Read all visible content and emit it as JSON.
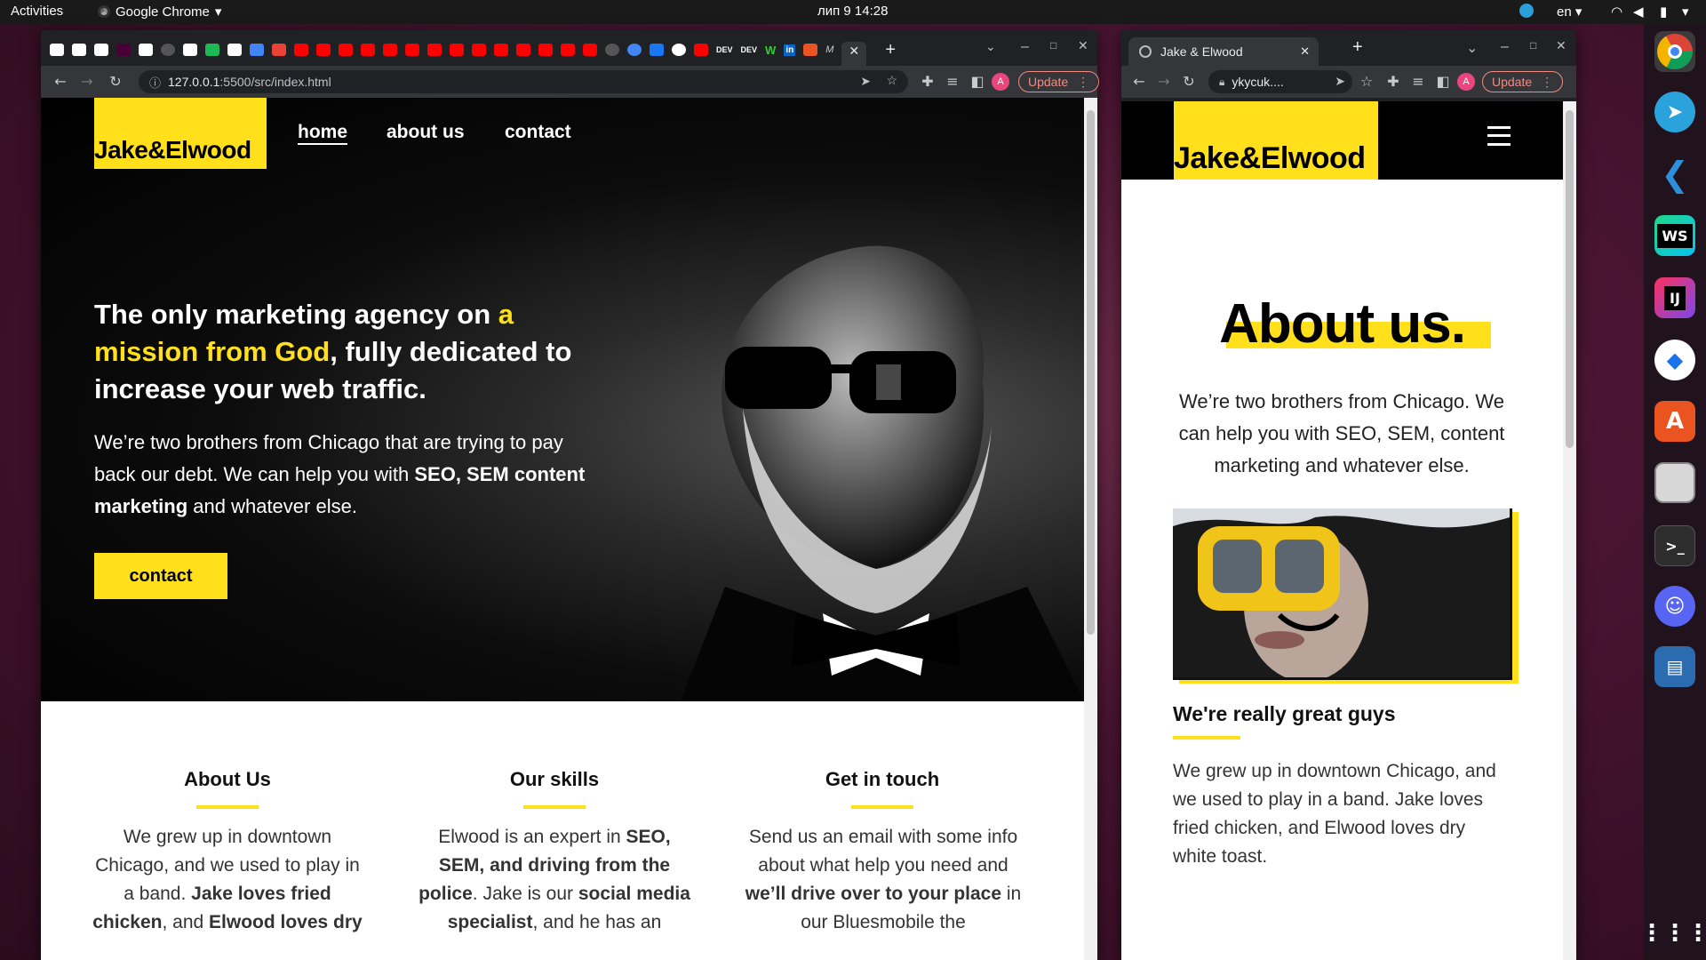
{
  "topbar": {
    "activities": "Activities",
    "app": "Google Chrome",
    "date_time": "лип 9  14:28",
    "lang": "en"
  },
  "win1": {
    "url_host": "127.0.0.1",
    "url_path": ":5500/src/index.html",
    "update": "Update",
    "avatar": "A",
    "tab_favicons": [
      "DEV",
      "DEV",
      "W",
      "in",
      "M"
    ]
  },
  "site": {
    "logo": "Jake&Elwood",
    "nav": [
      "home",
      "about us",
      "contact"
    ],
    "headline_1": "The only marketing agency on ",
    "headline_hl": "a mission from God",
    "headline_2": ", fully dedicated to increase your web traffic.",
    "lead_1": "We’re two brothers from Chicago that are trying to pay back our debt. We can help you with ",
    "lead_b1": "SEO, SEM content marketing",
    "lead_2": " and whatever else.",
    "cta": "contact",
    "cols": [
      {
        "title": "About Us",
        "t1": "We grew up in downtown Chicago, and we used to play in a band. ",
        "b1": "Jake loves fried chicken",
        "t2": ", and ",
        "b2": "Elwood loves dry"
      },
      {
        "title": "Our skills",
        "t1": "Elwood is an expert in ",
        "b1": "SEO, SEM, and driving from the police",
        "t2": ". Jake is our ",
        "b2": "social media specialist",
        "t3": ", and he has an"
      },
      {
        "title": "Get in touch",
        "t1": "Send us an email with some info about what help you need and ",
        "b1": "we’ll drive over to your place",
        "t2": " in our Bluesmobile the"
      }
    ]
  },
  "win2": {
    "tab_title": "Jake & Elwood",
    "url": "ykycuk....",
    "update": "Update",
    "avatar": "A",
    "about_title": "About us.",
    "about_text": "We’re two brothers from Chicago. We can help you with SEO, SEM, content marketing and whatever else.",
    "subhead": "We're really great guys",
    "body": "We grew up in downtown Chicago, and we used to play in a band. Jake loves fried chicken, and Elwood loves dry white toast."
  },
  "dock": [
    "chrome-icon",
    "telegram-icon",
    "vscode-icon",
    "webstorm-icon",
    "intellij-icon",
    "maps-icon",
    "software-center-icon",
    "files-icon",
    "terminal-icon",
    "discord-icon",
    "document-viewer-icon",
    "app-grid-icon"
  ],
  "dock_labels": {
    "webstorm": "WS",
    "intellij": "IJ",
    "terminal": ">_"
  },
  "colors": {
    "brand_yellow": "#ffe01b",
    "chrome_dark": "#202124",
    "update_red": "#f28b82"
  }
}
